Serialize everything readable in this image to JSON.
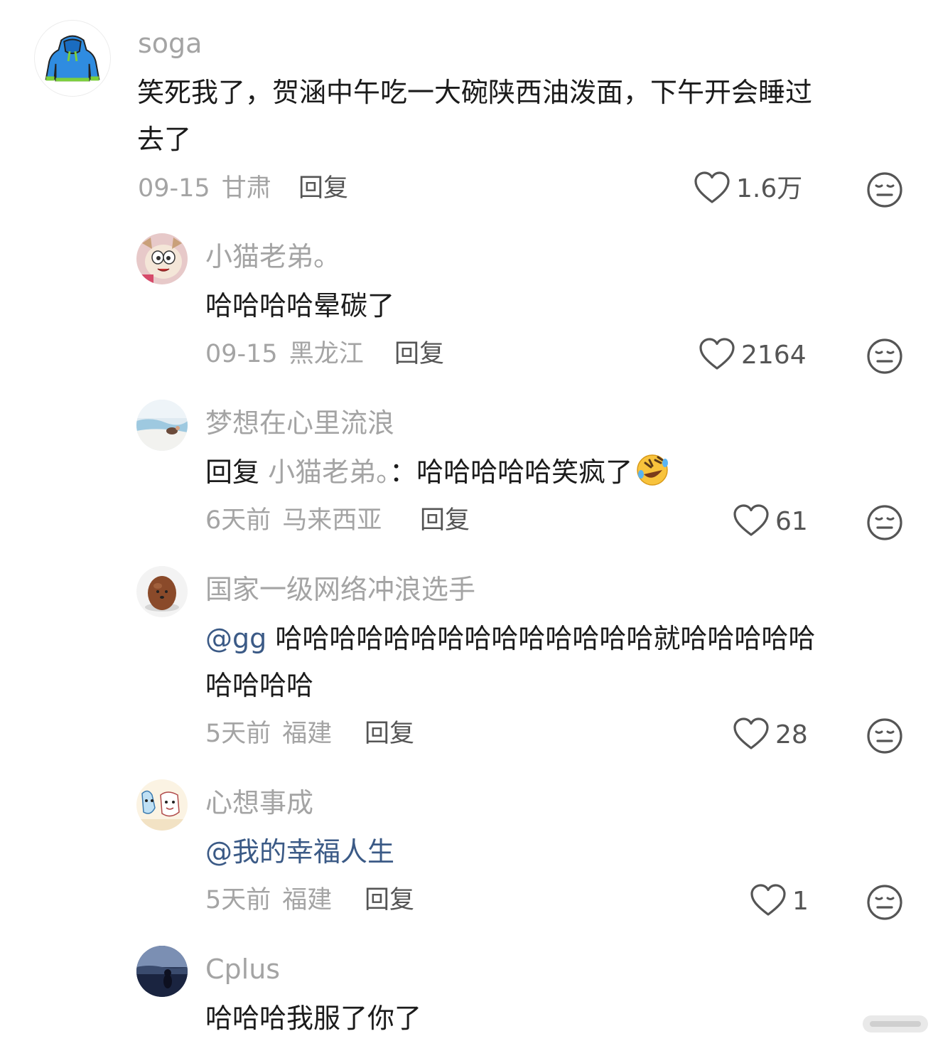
{
  "comments": [
    {
      "username": "soga",
      "avatar": "blue-hoodie-avatar",
      "text_line1": "笑死我了，贺涵中午吃一大碗陕西油泼面，下午开会睡过",
      "text_line2": "去了",
      "date": "09-15",
      "location": "甘肃",
      "reply_label": "回复",
      "likes": "1.6万"
    },
    {
      "username": "小猫老弟。",
      "avatar": "cartoon-cat-avatar",
      "text": "哈哈哈哈晕碳了",
      "date": "09-15",
      "location": "黑龙江",
      "reply_label": "回复",
      "likes": "2164"
    },
    {
      "username": "梦想在心里流浪",
      "avatar": "beach-photo-avatar",
      "reply_prefix": "回复",
      "reply_to": "小猫老弟。",
      "reply_colon": "：",
      "text": "哈哈哈哈哈笑疯了",
      "emoji": "rolling-on-floor-laughing",
      "date": "6天前",
      "location": "马来西亚",
      "reply_label": "回复",
      "likes": "61"
    },
    {
      "username": "国家一级网络冲浪选手",
      "avatar": "brown-egg-avatar",
      "mention": "@gg",
      "text_line1": " 哈哈哈哈哈哈哈哈哈哈哈哈哈哈就哈哈哈哈哈",
      "text_line2": "哈哈哈哈",
      "date": "5天前",
      "location": "福建",
      "reply_label": "回复",
      "likes": "28"
    },
    {
      "username": "心想事成",
      "avatar": "cartoon-sketch-avatar",
      "mention": "@我的幸福人生",
      "date": "5天前",
      "location": "福建",
      "reply_label": "回复",
      "likes": "1"
    },
    {
      "username": "Cplus",
      "avatar": "night-lake-avatar",
      "text": "哈哈哈我服了你了"
    }
  ],
  "colors": {
    "username": "#a4a4a4",
    "text": "#1b1b1b",
    "mention": "#3b5a86",
    "icon": "#555555"
  },
  "icons": [
    "heart-outline-icon",
    "meh-face-icon"
  ]
}
